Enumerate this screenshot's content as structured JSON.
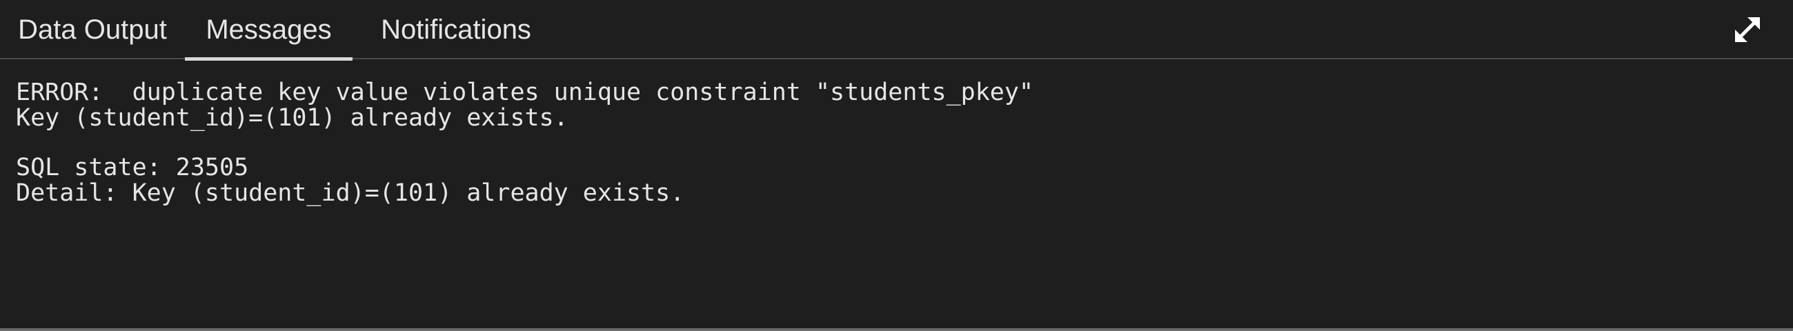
{
  "tabs": {
    "data_output": "Data Output",
    "messages": "Messages",
    "notifications": "Notifications",
    "active": "Messages"
  },
  "toolbar": {
    "expand_icon": "expand-icon"
  },
  "messages": {
    "line1": "ERROR:  duplicate key value violates unique constraint \"students_pkey\"",
    "line2": "Key (student_id)=(101) already exists.",
    "line3": "SQL state: 23505",
    "line4": "Detail: Key (student_id)=(101) already exists."
  },
  "colors": {
    "background": "#1e1e1e",
    "text": "#e6e6e6",
    "divider": "#4a4a4a",
    "active_tab_underline": "#d8d8d8"
  }
}
